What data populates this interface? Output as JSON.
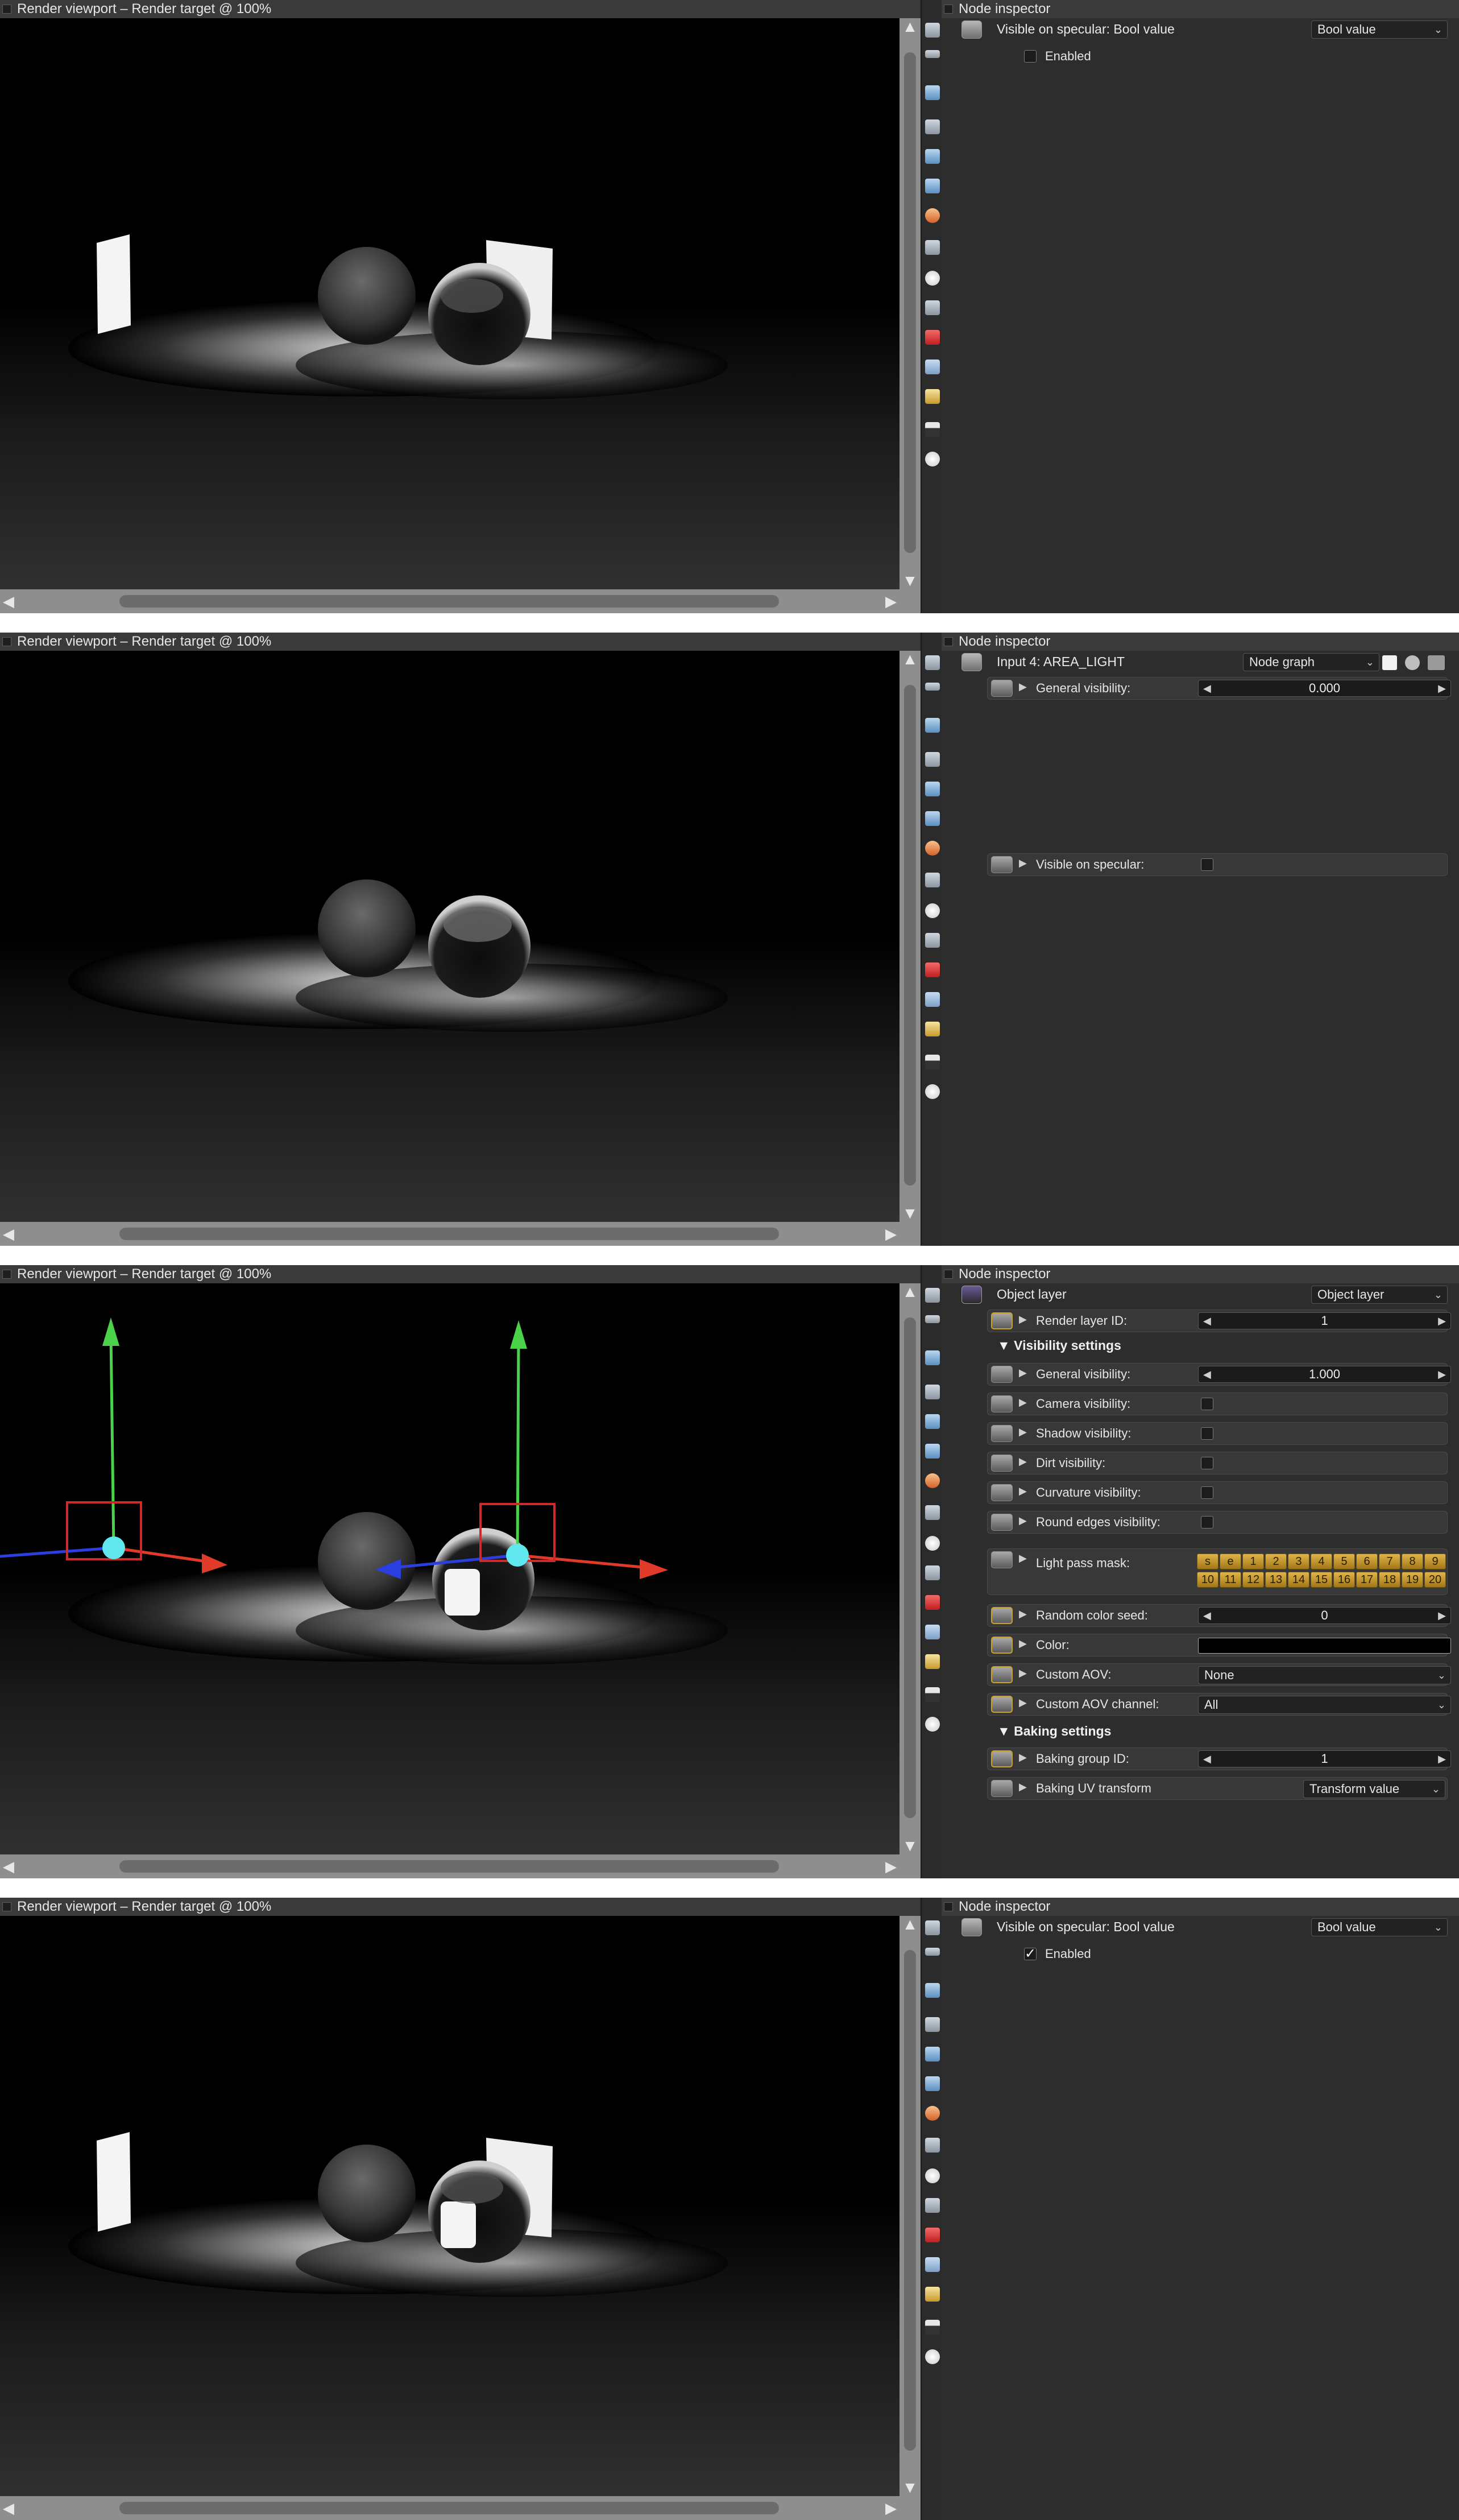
{
  "viewport_title": "Render viewport – Render target @ 100%",
  "inspector_title": "Node inspector",
  "panel1": {
    "header_label": "Visible on specular: Bool value",
    "combo_value": "Bool value",
    "enabled_label": "Enabled",
    "enabled_checked": false
  },
  "panel2": {
    "header_label": "Input 4: AREA_LIGHT",
    "combo_value": "Node graph",
    "general_visibility_label": "General visibility:",
    "general_visibility_value": "0.000",
    "visible_on_specular_label": "Visible on specular:"
  },
  "panel3": {
    "header_label": "Object layer",
    "combo_value": "Object layer",
    "render_layer_id_label": "Render layer ID:",
    "render_layer_id_value": "1",
    "visibility_section": "Visibility settings",
    "general_visibility_label": "General visibility:",
    "general_visibility_value": "1.000",
    "camera_visibility_label": "Camera visibility:",
    "shadow_visibility_label": "Shadow visibility:",
    "dirt_visibility_label": "Dirt visibility:",
    "curvature_visibility_label": "Curvature visibility:",
    "round_edges_visibility_label": "Round edges visibility:",
    "light_pass_mask_label": "Light pass mask:",
    "light_pass_row1": [
      "s",
      "e",
      "1",
      "2",
      "3",
      "4",
      "5",
      "6",
      "7",
      "8",
      "9"
    ],
    "light_pass_row2": [
      "10",
      "11",
      "12",
      "13",
      "14",
      "15",
      "16",
      "17",
      "18",
      "19",
      "20"
    ],
    "random_color_seed_label": "Random color seed:",
    "random_color_seed_value": "0",
    "color_label": "Color:",
    "custom_aov_label": "Custom AOV:",
    "custom_aov_value": "None",
    "custom_aov_channel_label": "Custom AOV channel:",
    "custom_aov_channel_value": "All",
    "baking_section": "Baking settings",
    "baking_group_id_label": "Baking group ID:",
    "baking_group_id_value": "1",
    "baking_uv_transform_label": "Baking UV transform",
    "baking_uv_transform_value": "Transform value"
  },
  "panel4": {
    "header_label": "Visible on specular: Bool value",
    "combo_value": "Bool value",
    "enabled_label": "Enabled",
    "enabled_mark": "✓"
  },
  "glyphs": {
    "tri_right": "▶",
    "tri_down": "▼",
    "arrow_left": "◀",
    "arrow_right": "▶",
    "arrow_up": "▲",
    "arrow_down": "▼",
    "combo_arrow": "⌄"
  },
  "toolbar_icons": [
    "layers-icon",
    "list-icon",
    "image-icon",
    "graph-icon",
    "cube-stack-icon",
    "cube-stack-2-icon",
    "paint-icon",
    "grid-icon",
    "clock-icon",
    "node-icon",
    "red-cube-icon",
    "blue-cube-icon",
    "yellow-cube-icon",
    "picture-icon",
    "sun-icon"
  ]
}
